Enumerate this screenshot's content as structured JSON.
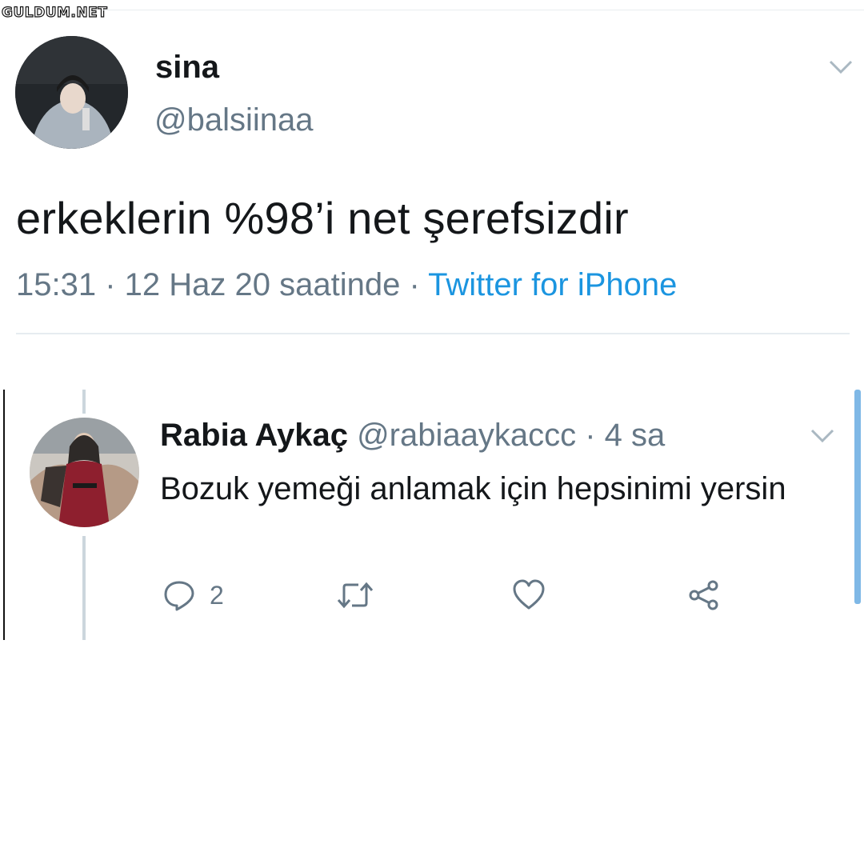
{
  "watermark": "GULDUM.NET",
  "tweet": {
    "display_name": "sina",
    "handle": "@balsiinaa",
    "text": "erkeklerin %98’i net şerefsizdir",
    "time_date": "15:31 · 12 Haz 20 saatinde · ",
    "source": "Twitter for iPhone"
  },
  "reply": {
    "display_name": "Rabia Aykaç",
    "handle_time": " @rabiaaykaccc · 4 sa",
    "text": "Bozuk yemeği anlamak için hepsinimi yersin",
    "reply_count": "2"
  },
  "icons": {
    "menu": "chevron-down-icon",
    "reply": "reply-icon",
    "retweet": "retweet-icon",
    "like": "heart-icon",
    "share": "share-icon"
  },
  "colors": {
    "secondary_text": "#657786",
    "link": "#1b95e0",
    "divider": "#e6ecf0"
  }
}
